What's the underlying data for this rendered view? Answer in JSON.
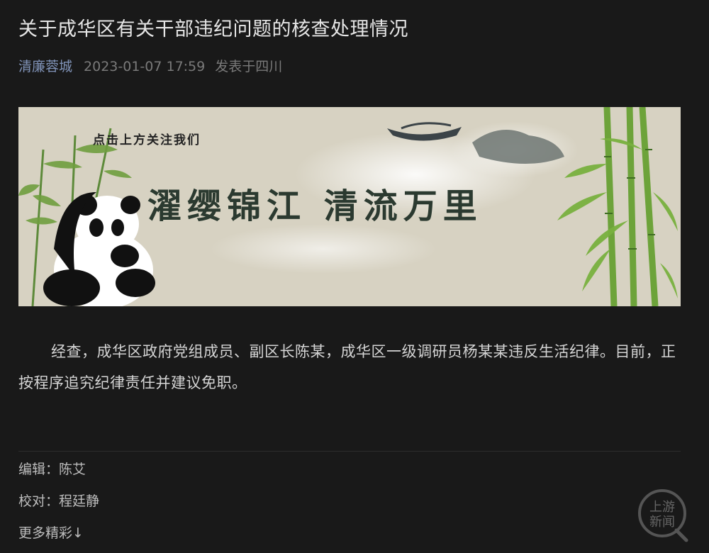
{
  "article": {
    "title": "关于成华区有关干部违纪问题的核查处理情况",
    "account": "清廉蓉城",
    "date": "2023-01-07 17:59",
    "location": "发表于四川",
    "paragraph": "经查，成华区政府党组成员、副区长陈某，成华区一级调研员杨某某违反生活纪律。目前，正按程序追究纪律责任并建议免职。"
  },
  "banner": {
    "follow_text": "点击上方关注我们",
    "slogan": "濯缨锦江  清流万里"
  },
  "footer": {
    "editor": "编辑：陈艾",
    "proofreader": "校对：程廷静",
    "more": "更多精彩↓"
  },
  "watermark": {
    "line1": "上游",
    "line2": "新闻"
  },
  "colors": {
    "background": "#191919",
    "account": "#8093b8",
    "meta": "#7a7a7a"
  }
}
